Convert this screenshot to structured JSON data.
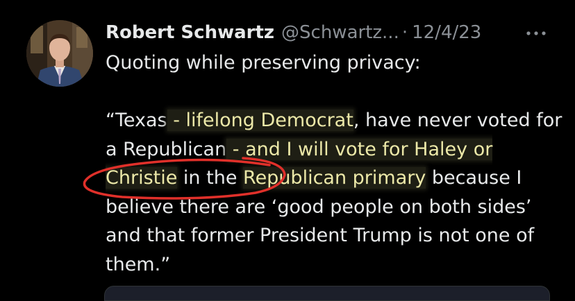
{
  "tweet": {
    "author_name": "Robert Schwartz",
    "handle": "@Schwartz...",
    "separator": "·",
    "date": "12/4/23",
    "more_icon": "more-horizontal-icon",
    "intro": "Quoting while preserving privacy:",
    "quote": {
      "seg1": "“Texas",
      "seg2": " - lifelong Democrat",
      "seg3": ", have never voted for a Republican",
      "seg4": " - and I will vote for Haley or Christie",
      "seg5": " in the ",
      "seg6": "Republican primary",
      "seg7": " because I believe there are ‘good people on both sides’ and that former President Trump is not one of them.”"
    }
  },
  "colors": {
    "background": "#000000",
    "text": "#e7e9ea",
    "secondary": "#8b9096",
    "highlight_text": "#ece8a8",
    "annotation_red": "#e0302a"
  }
}
